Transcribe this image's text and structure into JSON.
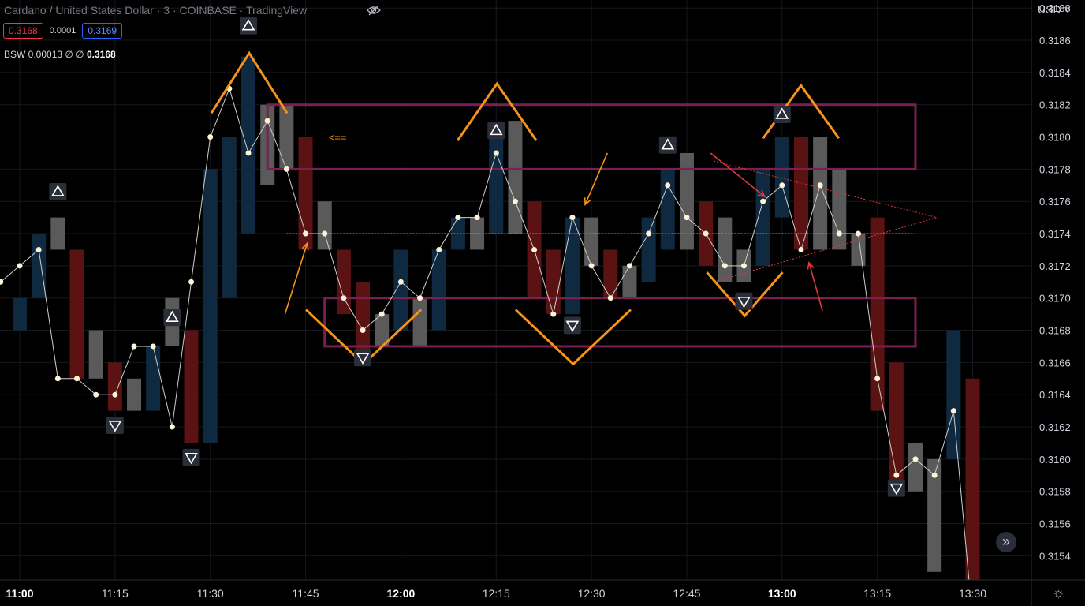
{
  "header": {
    "title": "Cardano / United States Dollar · 3 · COINBASE · TradingView",
    "bid": "0.3168",
    "spread": "0.0001",
    "ask": "0.3169",
    "indicator_name": "BSW 0.00013",
    "indicator_params": "∅ ∅",
    "indicator_value": "0.3168",
    "currency": "USD"
  },
  "icons": {
    "hide": "eye-off-icon",
    "scroll": "fast-forward-icon",
    "settings": "gear-icon",
    "currency_menu": "chevron-down-icon"
  },
  "colors": {
    "background": "#000000",
    "bull_candle": "#0f2a40",
    "bear_candle": "#5a1212",
    "neutral_candle": "#5a5a5a",
    "line": "#cfcfcf",
    "marker": "#fff3d6",
    "annotation_orange": "#f7931a",
    "zone_border": "#7a1f4f",
    "red_arrow": "#e03a3a"
  },
  "chart_data": {
    "type": "candlestick",
    "y_ticks": [
      "0.3154",
      "0.3156",
      "0.3158",
      "0.3160",
      "0.3162",
      "0.3164",
      "0.3166",
      "0.3168",
      "0.3170",
      "0.3172",
      "0.3174",
      "0.3176",
      "0.3178",
      "0.3180",
      "0.3182",
      "0.3184",
      "0.3186",
      "0.3188"
    ],
    "x_ticks": [
      "11:00",
      "11:15",
      "11:30",
      "11:45",
      "12:00",
      "12:15",
      "12:30",
      "12:45",
      "13:00",
      "13:15",
      "13:30"
    ],
    "ylim": [
      0.31525,
      0.31885
    ],
    "grid": true,
    "candles": [
      {
        "time": "11:00",
        "o": 0.3168,
        "c": 0.317,
        "dir": "up"
      },
      {
        "time": "11:03",
        "o": 0.317,
        "c": 0.3174,
        "dir": "up"
      },
      {
        "time": "11:06",
        "o": 0.3173,
        "c": 0.3175,
        "dir": "flat"
      },
      {
        "time": "11:09",
        "o": 0.3173,
        "c": 0.3165,
        "dir": "down"
      },
      {
        "time": "11:12",
        "o": 0.3165,
        "c": 0.3168,
        "dir": "flat"
      },
      {
        "time": "11:15",
        "o": 0.3166,
        "c": 0.3163,
        "dir": "down"
      },
      {
        "time": "11:18",
        "o": 0.3163,
        "c": 0.3165,
        "dir": "flat"
      },
      {
        "time": "11:21",
        "o": 0.3163,
        "c": 0.3167,
        "dir": "up"
      },
      {
        "time": "11:24",
        "o": 0.3167,
        "c": 0.317,
        "dir": "flat"
      },
      {
        "time": "11:27",
        "o": 0.3168,
        "c": 0.3161,
        "dir": "down"
      },
      {
        "time": "11:30",
        "o": 0.3161,
        "c": 0.3178,
        "dir": "up"
      },
      {
        "time": "11:33",
        "o": 0.317,
        "c": 0.318,
        "dir": "up"
      },
      {
        "time": "11:36",
        "o": 0.3174,
        "c": 0.3185,
        "dir": "up"
      },
      {
        "time": "11:39",
        "o": 0.3177,
        "c": 0.3182,
        "dir": "flat"
      },
      {
        "time": "11:42",
        "o": 0.3178,
        "c": 0.3182,
        "dir": "flat"
      },
      {
        "time": "11:45",
        "o": 0.318,
        "c": 0.3173,
        "dir": "down"
      },
      {
        "time": "11:48",
        "o": 0.3173,
        "c": 0.3176,
        "dir": "flat"
      },
      {
        "time": "11:51",
        "o": 0.3173,
        "c": 0.3169,
        "dir": "down"
      },
      {
        "time": "11:54",
        "o": 0.3171,
        "c": 0.3166,
        "dir": "down"
      },
      {
        "time": "11:57",
        "o": 0.3167,
        "c": 0.3169,
        "dir": "flat"
      },
      {
        "time": "12:00",
        "o": 0.3168,
        "c": 0.3173,
        "dir": "up"
      },
      {
        "time": "12:03",
        "o": 0.3167,
        "c": 0.317,
        "dir": "flat"
      },
      {
        "time": "12:06",
        "o": 0.3168,
        "c": 0.3173,
        "dir": "up"
      },
      {
        "time": "12:09",
        "o": 0.3173,
        "c": 0.3175,
        "dir": "up"
      },
      {
        "time": "12:12",
        "o": 0.3173,
        "c": 0.3175,
        "dir": "flat"
      },
      {
        "time": "12:15",
        "o": 0.3174,
        "c": 0.318,
        "dir": "up"
      },
      {
        "time": "12:18",
        "o": 0.3174,
        "c": 0.3181,
        "dir": "flat"
      },
      {
        "time": "12:21",
        "o": 0.3176,
        "c": 0.317,
        "dir": "down"
      },
      {
        "time": "12:24",
        "o": 0.3173,
        "c": 0.3169,
        "dir": "down"
      },
      {
        "time": "12:27",
        "o": 0.3169,
        "c": 0.3175,
        "dir": "up"
      },
      {
        "time": "12:30",
        "o": 0.3172,
        "c": 0.3175,
        "dir": "flat"
      },
      {
        "time": "12:33",
        "o": 0.3173,
        "c": 0.317,
        "dir": "down"
      },
      {
        "time": "12:36",
        "o": 0.317,
        "c": 0.3172,
        "dir": "flat"
      },
      {
        "time": "12:39",
        "o": 0.3171,
        "c": 0.3175,
        "dir": "up"
      },
      {
        "time": "12:42",
        "o": 0.3173,
        "c": 0.3178,
        "dir": "up"
      },
      {
        "time": "12:45",
        "o": 0.3173,
        "c": 0.3179,
        "dir": "flat"
      },
      {
        "time": "12:48",
        "o": 0.3176,
        "c": 0.3172,
        "dir": "down"
      },
      {
        "time": "12:51",
        "o": 0.3171,
        "c": 0.3175,
        "dir": "flat"
      },
      {
        "time": "12:54",
        "o": 0.3171,
        "c": 0.3173,
        "dir": "flat"
      },
      {
        "time": "12:57",
        "o": 0.3172,
        "c": 0.3178,
        "dir": "up"
      },
      {
        "time": "13:00",
        "o": 0.3175,
        "c": 0.318,
        "dir": "up"
      },
      {
        "time": "13:03",
        "o": 0.318,
        "c": 0.3173,
        "dir": "down"
      },
      {
        "time": "13:06",
        "o": 0.3173,
        "c": 0.318,
        "dir": "flat"
      },
      {
        "time": "13:09",
        "o": 0.3173,
        "c": 0.3178,
        "dir": "flat"
      },
      {
        "time": "13:12",
        "o": 0.3172,
        "c": 0.3174,
        "dir": "flat"
      },
      {
        "time": "13:15",
        "o": 0.3175,
        "c": 0.3163,
        "dir": "down"
      },
      {
        "time": "13:18",
        "o": 0.3166,
        "c": 0.3158,
        "dir": "down"
      },
      {
        "time": "13:21",
        "o": 0.3158,
        "c": 0.3161,
        "dir": "flat"
      },
      {
        "time": "13:24",
        "o": 0.3153,
        "c": 0.316,
        "dir": "flat"
      },
      {
        "time": "13:27",
        "o": 0.316,
        "c": 0.3168,
        "dir": "up"
      },
      {
        "time": "13:30",
        "o": 0.3165,
        "c": 0.3152,
        "dir": "down"
      }
    ],
    "line": [
      0.3171,
      0.3172,
      0.3173,
      0.3165,
      0.3165,
      0.3164,
      0.3164,
      0.3167,
      0.3167,
      0.3162,
      0.3171,
      0.318,
      0.3183,
      0.3179,
      0.3181,
      0.3178,
      0.3174,
      0.3174,
      0.317,
      0.3168,
      0.3169,
      0.3171,
      0.317,
      0.3173,
      0.3175,
      0.3175,
      0.3179,
      0.3176,
      0.3173,
      0.3169,
      0.3175,
      0.3172,
      0.317,
      0.3172,
      0.3174,
      0.3177,
      0.3175,
      0.3174,
      0.3172,
      0.3172,
      0.3176,
      0.3177,
      0.3173,
      0.3177,
      0.3174,
      0.3174,
      0.3165,
      0.3159,
      0.316,
      0.3159,
      0.3163,
      0.315
    ],
    "swing_up": [
      {
        "time": "11:06",
        "price": 0.31766
      },
      {
        "time": "11:24",
        "price": 0.31688
      },
      {
        "time": "11:36",
        "price": 0.31869
      },
      {
        "time": "12:15",
        "price": 0.31804
      },
      {
        "time": "12:42",
        "price": 0.31795
      },
      {
        "time": "13:00",
        "price": 0.31814
      }
    ],
    "swing_down": [
      {
        "time": "11:15",
        "price": 0.31621
      },
      {
        "time": "11:27",
        "price": 0.31601
      },
      {
        "time": "11:54",
        "price": 0.31663
      },
      {
        "time": "12:27",
        "price": 0.31683
      },
      {
        "time": "12:54",
        "price": 0.31698
      },
      {
        "time": "13:18",
        "price": 0.31582
      }
    ],
    "zones": [
      {
        "t_start": "11:39",
        "t_end": "13:21",
        "p_top": 0.3182,
        "p_bottom": 0.3178
      },
      {
        "t_start": "11:48",
        "t_end": "13:21",
        "p_top": 0.317,
        "p_bottom": 0.3167
      }
    ],
    "mid_line": {
      "t_start": "11:42",
      "t_end": "13:21",
      "price": 0.3174
    },
    "annotation_text": "<==",
    "annotation_time": "11:48",
    "annotation_price": 0.318
  }
}
